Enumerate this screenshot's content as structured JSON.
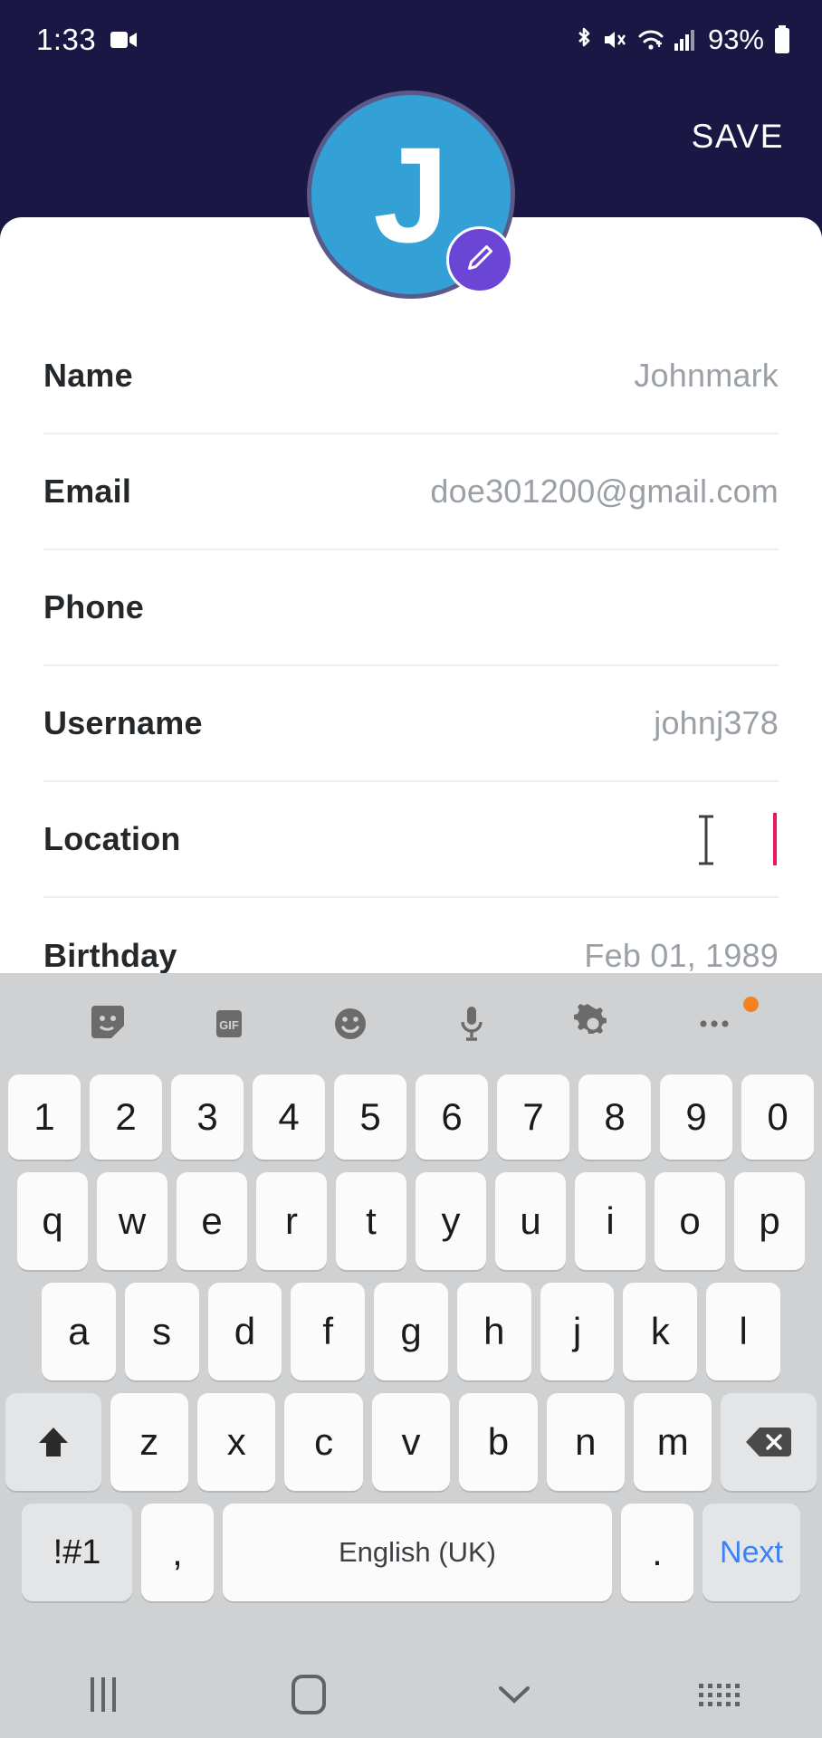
{
  "statusbar": {
    "time": "1:33",
    "battery_percent": "93%",
    "icons": [
      "screen-record-icon",
      "bluetooth-icon",
      "mute-vibrate-icon",
      "wifi-icon",
      "signal-icon",
      "battery-icon"
    ]
  },
  "header": {
    "save_label": "SAVE",
    "background_color": "#1b1745"
  },
  "avatar": {
    "initial": "J",
    "background_color": "#33a0d6",
    "edit_badge_color": "#6b46d6",
    "edit_icon": "pencil-icon"
  },
  "form": {
    "fields": [
      {
        "label": "Name",
        "value": "Johnmark"
      },
      {
        "label": "Email",
        "value": "doe301200@gmail.com"
      },
      {
        "label": "Phone",
        "value": ""
      },
      {
        "label": "Username",
        "value": "johnj378"
      },
      {
        "label": "Location",
        "value": ""
      },
      {
        "label": "Birthday",
        "value": "Feb 01, 1989"
      }
    ],
    "focused_field": "Location",
    "caret_color": "#e5185e"
  },
  "keyboard": {
    "background_color": "#d0d1d2",
    "toolbar": [
      "sticker-icon",
      "gif-icon",
      "emoji-icon",
      "microphone-icon",
      "settings-gear-icon",
      "more-options-icon"
    ],
    "badge_color": "#f5821f",
    "row_numbers": [
      "1",
      "2",
      "3",
      "4",
      "5",
      "6",
      "7",
      "8",
      "9",
      "0"
    ],
    "row_top": [
      "q",
      "w",
      "e",
      "r",
      "t",
      "y",
      "u",
      "i",
      "o",
      "p"
    ],
    "row_home": [
      "a",
      "s",
      "d",
      "f",
      "g",
      "h",
      "j",
      "k",
      "l"
    ],
    "row_bottom": [
      "z",
      "x",
      "c",
      "v",
      "b",
      "n",
      "m"
    ],
    "shift_icon": "shift-up-arrow-icon",
    "backspace_icon": "backspace-icon",
    "symbols_label": "!#1",
    "comma_label": ",",
    "space_label": "English (UK)",
    "period_label": ".",
    "next_label": "Next",
    "next_color": "#3b82f6"
  },
  "navbar": {
    "items": [
      "recents-icon",
      "home-icon",
      "hide-keyboard-icon",
      "keyboard-switcher-icon"
    ]
  }
}
